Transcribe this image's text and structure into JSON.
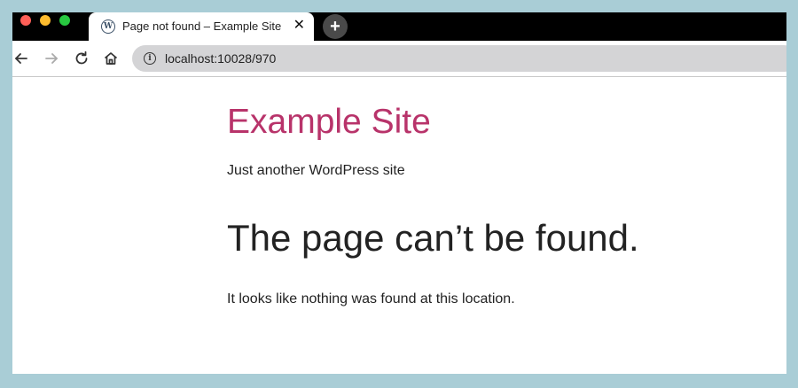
{
  "browser": {
    "tab": {
      "favicon": "W",
      "title": "Page not found – Example Site",
      "close": "✕"
    },
    "new_tab": "+",
    "url": "localhost:10028/970",
    "info": "i"
  },
  "page": {
    "site_title": "Example Site",
    "tagline": "Just another WordPress site",
    "heading": "The page can’t be found.",
    "message": "It looks like nothing was found at this location."
  },
  "colors": {
    "site_title": "#b8336a",
    "desktop_background": "#a9cdd6"
  }
}
